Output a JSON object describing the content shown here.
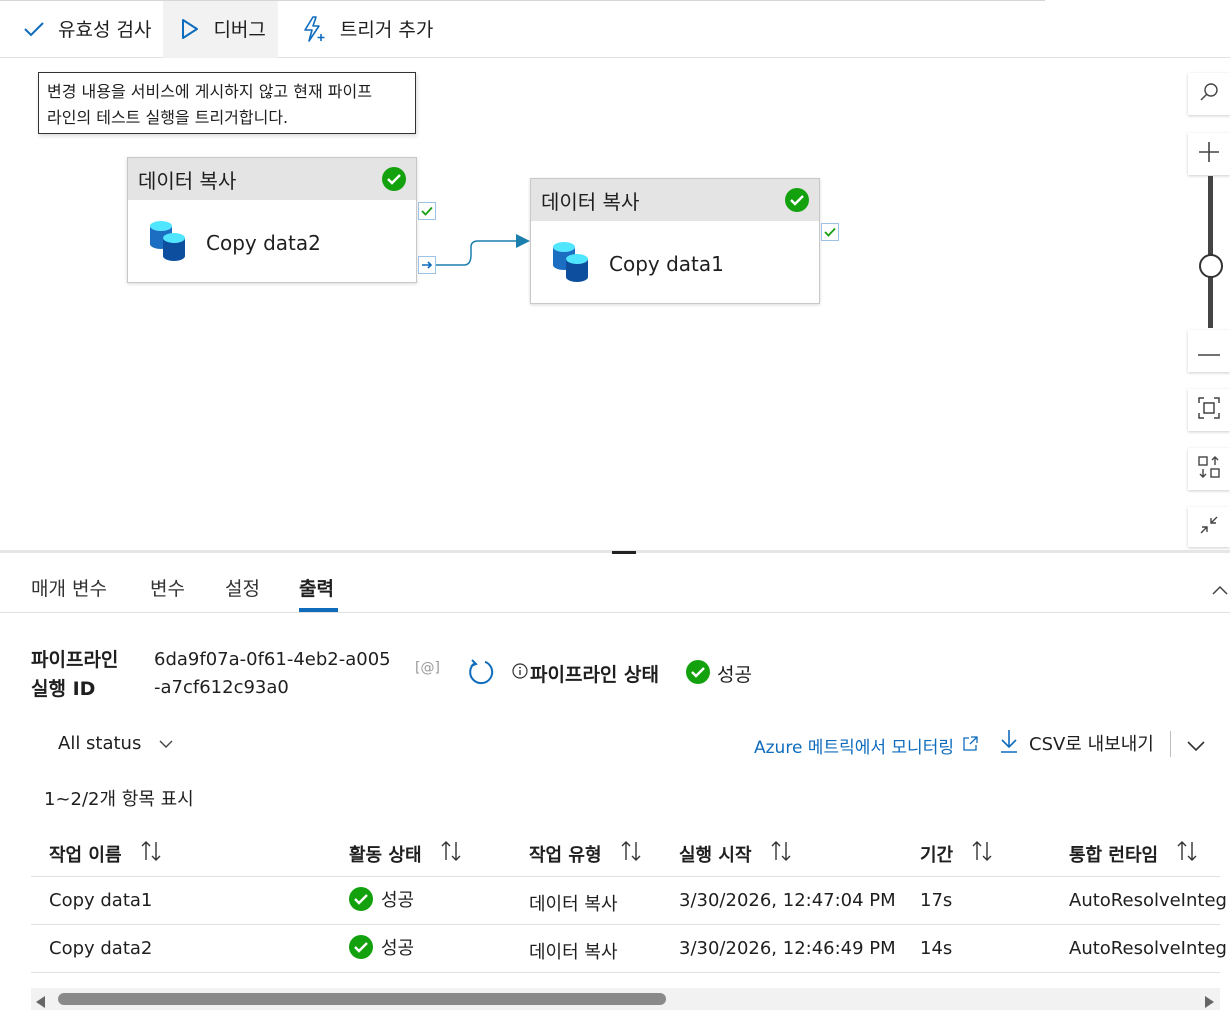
{
  "toolbar": {
    "validate_label": "유효성 검사",
    "debug_label": "디버그",
    "add_trigger_label": "트리거 추가"
  },
  "tooltip": {
    "line1": "변경 내용을 서비스에 게시하지 않고 현재 파이프",
    "line2": "라인의 테스트 실행을 트리거합니다."
  },
  "canvas": {
    "activities": [
      {
        "type_label": "데이터 복사",
        "name": "Copy data2",
        "status_icon": "success-check-icon"
      },
      {
        "type_label": "데이터 복사",
        "name": "Copy data1",
        "status_icon": "success-check-icon"
      }
    ]
  },
  "tabs": [
    {
      "label": "매개 변수"
    },
    {
      "label": "변수"
    },
    {
      "label": "설정"
    },
    {
      "label": "출력",
      "active": true
    }
  ],
  "output": {
    "run_id_label_line1": "파이프라인",
    "run_id_label_line2": "실행 ID",
    "run_id_line1": "6da9f07a-0f61-4eb2-a005",
    "run_id_line2": "-a7cf612c93a0",
    "copy_icon_text": "[@]",
    "status_label": "파이프라인 상태",
    "status_value": "성공",
    "filter_label": "All status",
    "monitor_link": "Azure 메트릭에서 모니터링",
    "export_label": "CSV로 내보내기",
    "count_text": "1~2/2개 항목 표시"
  },
  "table": {
    "columns": [
      "작업 이름",
      "활동 상태",
      "작업 유형",
      "실행 시작",
      "기간",
      "통합 런타임"
    ],
    "rows": [
      {
        "name": "Copy data1",
        "status": "성공",
        "type": "데이터 복사",
        "start": "3/30/2026, 12:47:04 PM",
        "duration": "17s",
        "runtime": "AutoResolveInteg"
      },
      {
        "name": "Copy data2",
        "status": "성공",
        "type": "데이터 복사",
        "start": "3/30/2026, 12:46:49 PM",
        "duration": "14s",
        "runtime": "AutoResolveInteg"
      }
    ]
  },
  "colors": {
    "accent": "#0f6cbd",
    "success": "#13a10e",
    "connector": "#1b7fae"
  }
}
